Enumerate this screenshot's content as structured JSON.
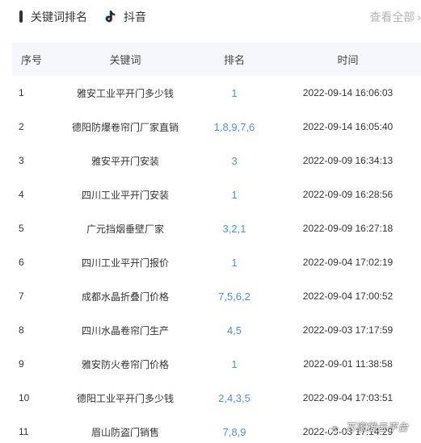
{
  "header": {
    "title": "关键词排名",
    "platform_icon": "tiktok-note-icon",
    "platform": "抖音",
    "view_all": "查看全部",
    "view_all_icon": "chevron-right-icon"
  },
  "table": {
    "columns": [
      "序号",
      "关键词",
      "排名",
      "时间"
    ],
    "rows": [
      {
        "index": "1",
        "keyword": "雅安工业平开门多少钱",
        "rank": "1",
        "time": "2022-09-14 16:06:03"
      },
      {
        "index": "2",
        "keyword": "德阳防爆卷帘门厂家直销",
        "rank": "1,8,9,7,6",
        "time": "2022-09-14 16:05:40"
      },
      {
        "index": "3",
        "keyword": "雅安平开门安装",
        "rank": "3",
        "time": "2022-09-09 16:34:13"
      },
      {
        "index": "4",
        "keyword": "四川工业平开门安装",
        "rank": "1",
        "time": "2022-09-09 16:28:56"
      },
      {
        "index": "5",
        "keyword": "广元挡烟垂壁厂家",
        "rank": "3,2,1",
        "time": "2022-09-09 16:27:18"
      },
      {
        "index": "6",
        "keyword": "四川工业平开门报价",
        "rank": "1",
        "time": "2022-09-04 17:02:19"
      },
      {
        "index": "7",
        "keyword": "成都水晶折叠门价格",
        "rank": "7,5,6,2",
        "time": "2022-09-04 17:00:52"
      },
      {
        "index": "8",
        "keyword": "四川水晶卷帘门生产",
        "rank": "4,5",
        "time": "2022-09-03 17:17:59"
      },
      {
        "index": "9",
        "keyword": "雅安防火卷帘门价格",
        "rank": "1",
        "time": "2022-09-01 11:38:58"
      },
      {
        "index": "10",
        "keyword": "德阳工业平开门多少钱",
        "rank": "2,4,3,5",
        "time": "2022-09-04 17:03:51"
      },
      {
        "index": "11",
        "keyword": "眉山防盗门销售",
        "rank": "7,8,9",
        "time": "2022-09-03 17:14:29"
      }
    ]
  },
  "watermark": {
    "text": "万家推云平台",
    "icon": "wechat-icon"
  },
  "colors": {
    "rank_blue": "#4a90e2",
    "header_bg": "#f6f7fb",
    "muted": "#b4b4b4",
    "tiktok_cyan": "#25f4ee",
    "tiktok_red": "#fe2c55"
  }
}
